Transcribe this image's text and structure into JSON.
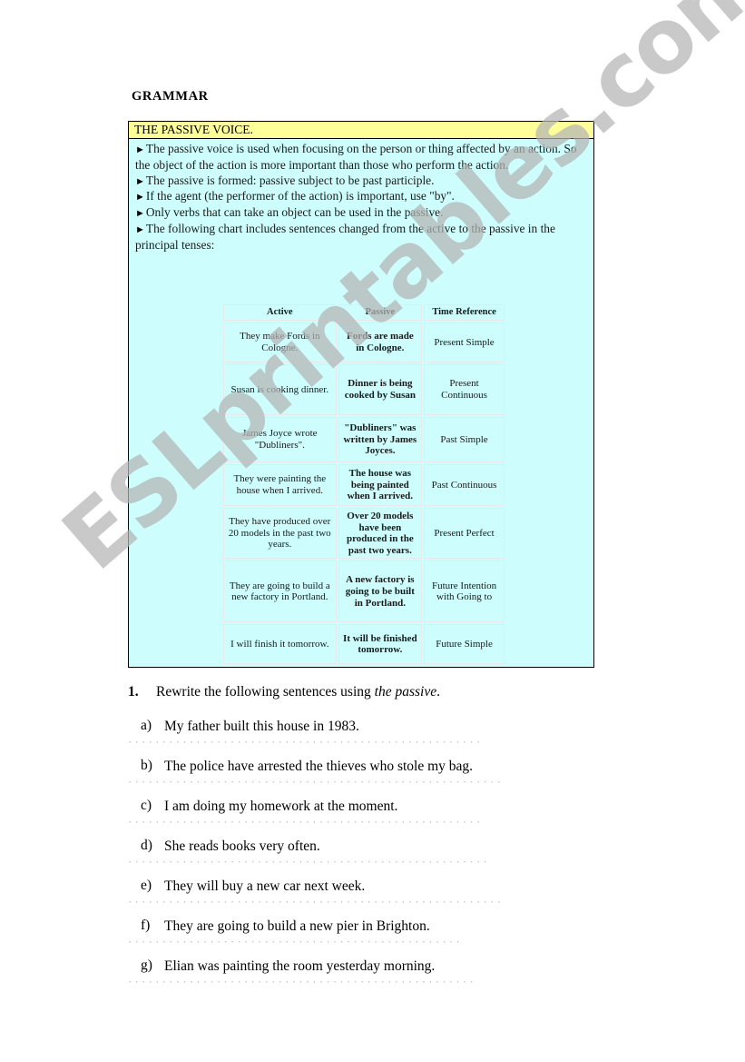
{
  "page": {
    "heading": "GRAMMAR",
    "watermark": "ESLprintables.com",
    "colors": {
      "box_fill": "#cdfdfd",
      "banner_fill": "#ffff99",
      "border": "#000000",
      "watermark": "#b5b5b5",
      "dots": "#bdbdbd"
    }
  },
  "passive_box": {
    "banner_title": "THE PASSIVE VOICE.",
    "bullet_marker": "►",
    "bullets": [
      "The passive voice is used when focusing on the person or thing affected by an action. So the object of the action is more important than those who perform the action.",
      "The passive is formed: passive subject to be past participle.",
      "If the agent (the performer of the action) is important, use \"by\".",
      "Only verbs that can take an object can be used in the passive.",
      "The following chart includes sentences changed from the active to the passive in the principal tenses:"
    ]
  },
  "tense_table": {
    "headers": [
      "Active",
      "Passive",
      "Time Reference"
    ],
    "rows": [
      {
        "active": "They make Fords in Cologne.",
        "passive": "Fords are made in Cologne.",
        "time": "Present Simple"
      },
      {
        "active": "Susan is cooking dinner.",
        "passive": "Dinner is being cooked by Susan",
        "time": "Present Continuous"
      },
      {
        "active": "James Joyce wrote \"Dubliners\".",
        "passive": "\"Dubliners\" was written by James Joyces.",
        "time": "Past Simple"
      },
      {
        "active": "They were painting the house when I arrived.",
        "passive": "The house was being painted when I arrived.",
        "time": "Past Continuous"
      },
      {
        "active": "They have produced over 20 models in the past two years.",
        "passive": "Over 20 models have been produced in the past two years.",
        "time": "Present Perfect"
      },
      {
        "active": "They are going to build a new factory in Portland.",
        "passive": "A new factory is going to be built in Portland.",
        "time": "Future Intention with Going to"
      },
      {
        "active": "I will finish it tomorrow.",
        "passive": "It will be finished tomorrow.",
        "time": "Future Simple"
      }
    ]
  },
  "exercise": {
    "number": "1.",
    "instruction_before": "Rewrite the following sentences using ",
    "instruction_italic": "the passive",
    "instruction_after": ".",
    "items": [
      {
        "letter": "a)",
        "sentence": "My father built this house in 1983."
      },
      {
        "letter": "b)",
        "sentence": "The police have arrested the thieves who stole my bag."
      },
      {
        "letter": "c)",
        "sentence": "I am doing my homework at the moment."
      },
      {
        "letter": "d)",
        "sentence": "She reads books very often."
      },
      {
        "letter": "e)",
        "sentence": "They will buy a new car next week."
      },
      {
        "letter": "f)",
        "sentence": "They are going to build a new pier in Brighton."
      },
      {
        "letter": "g)",
        "sentence": "Elian was painting the room yesterday morning."
      }
    ],
    "answer_line": "························································································································"
  }
}
